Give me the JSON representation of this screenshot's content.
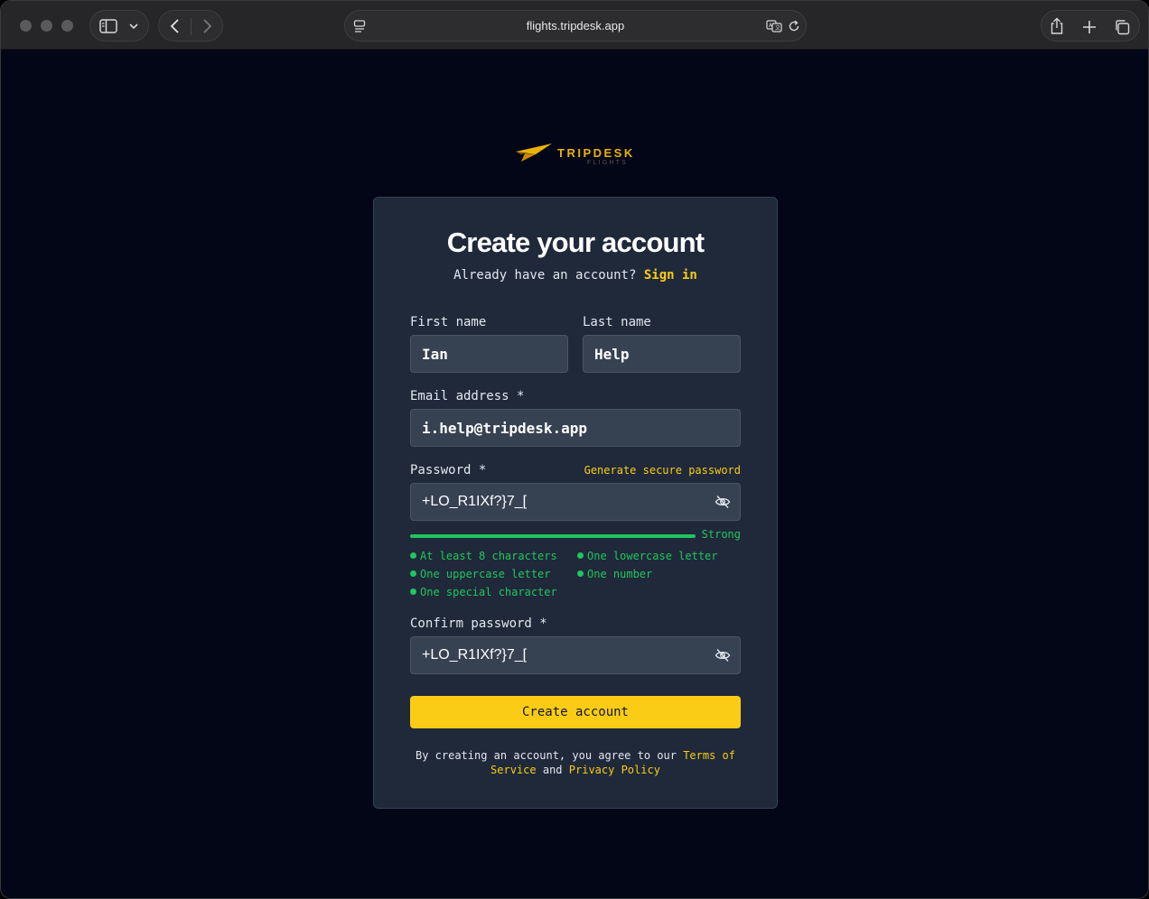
{
  "browser": {
    "url": "flights.tripdesk.app"
  },
  "brand": {
    "name": "TRIPDESK",
    "sub": "FLIGHTS",
    "accent": "#facc15",
    "success": "#22c55e"
  },
  "signup": {
    "title": "Create your account",
    "have_account": "Already have an account?",
    "sign_in": "Sign in",
    "first_name": {
      "label": "First name",
      "value": "Ian"
    },
    "last_name": {
      "label": "Last name",
      "value": "Help"
    },
    "email": {
      "label": "Email address *",
      "value": "i.help@tripdesk.app"
    },
    "password": {
      "label": "Password *",
      "generate": "Generate secure password",
      "value": "+LO_R1IXf?}7_[",
      "strength": "Strong",
      "strength_level": 1.0
    },
    "requirements": [
      "At least 8 characters",
      "One lowercase letter",
      "One uppercase letter",
      "One number",
      "One special character"
    ],
    "confirm_password": {
      "label": "Confirm password *",
      "value": "+LO_R1IXf?}7_["
    },
    "submit": "Create account",
    "legal": {
      "prefix": "By creating an account, you agree to our",
      "terms": "Terms of Service",
      "and": "and",
      "privacy": "Privacy Policy"
    }
  }
}
